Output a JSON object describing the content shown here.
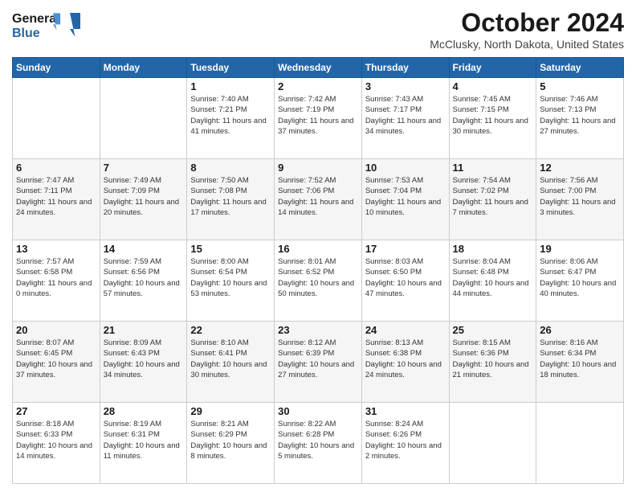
{
  "logo": {
    "line1": "General",
    "line2": "Blue"
  },
  "title": "October 2024",
  "location": "McClusky, North Dakota, United States",
  "days_of_week": [
    "Sunday",
    "Monday",
    "Tuesday",
    "Wednesday",
    "Thursday",
    "Friday",
    "Saturday"
  ],
  "weeks": [
    [
      {
        "day": "",
        "sunrise": "",
        "sunset": "",
        "daylight": ""
      },
      {
        "day": "",
        "sunrise": "",
        "sunset": "",
        "daylight": ""
      },
      {
        "day": "1",
        "sunrise": "Sunrise: 7:40 AM",
        "sunset": "Sunset: 7:21 PM",
        "daylight": "Daylight: 11 hours and 41 minutes."
      },
      {
        "day": "2",
        "sunrise": "Sunrise: 7:42 AM",
        "sunset": "Sunset: 7:19 PM",
        "daylight": "Daylight: 11 hours and 37 minutes."
      },
      {
        "day": "3",
        "sunrise": "Sunrise: 7:43 AM",
        "sunset": "Sunset: 7:17 PM",
        "daylight": "Daylight: 11 hours and 34 minutes."
      },
      {
        "day": "4",
        "sunrise": "Sunrise: 7:45 AM",
        "sunset": "Sunset: 7:15 PM",
        "daylight": "Daylight: 11 hours and 30 minutes."
      },
      {
        "day": "5",
        "sunrise": "Sunrise: 7:46 AM",
        "sunset": "Sunset: 7:13 PM",
        "daylight": "Daylight: 11 hours and 27 minutes."
      }
    ],
    [
      {
        "day": "6",
        "sunrise": "Sunrise: 7:47 AM",
        "sunset": "Sunset: 7:11 PM",
        "daylight": "Daylight: 11 hours and 24 minutes."
      },
      {
        "day": "7",
        "sunrise": "Sunrise: 7:49 AM",
        "sunset": "Sunset: 7:09 PM",
        "daylight": "Daylight: 11 hours and 20 minutes."
      },
      {
        "day": "8",
        "sunrise": "Sunrise: 7:50 AM",
        "sunset": "Sunset: 7:08 PM",
        "daylight": "Daylight: 11 hours and 17 minutes."
      },
      {
        "day": "9",
        "sunrise": "Sunrise: 7:52 AM",
        "sunset": "Sunset: 7:06 PM",
        "daylight": "Daylight: 11 hours and 14 minutes."
      },
      {
        "day": "10",
        "sunrise": "Sunrise: 7:53 AM",
        "sunset": "Sunset: 7:04 PM",
        "daylight": "Daylight: 11 hours and 10 minutes."
      },
      {
        "day": "11",
        "sunrise": "Sunrise: 7:54 AM",
        "sunset": "Sunset: 7:02 PM",
        "daylight": "Daylight: 11 hours and 7 minutes."
      },
      {
        "day": "12",
        "sunrise": "Sunrise: 7:56 AM",
        "sunset": "Sunset: 7:00 PM",
        "daylight": "Daylight: 11 hours and 3 minutes."
      }
    ],
    [
      {
        "day": "13",
        "sunrise": "Sunrise: 7:57 AM",
        "sunset": "Sunset: 6:58 PM",
        "daylight": "Daylight: 11 hours and 0 minutes."
      },
      {
        "day": "14",
        "sunrise": "Sunrise: 7:59 AM",
        "sunset": "Sunset: 6:56 PM",
        "daylight": "Daylight: 10 hours and 57 minutes."
      },
      {
        "day": "15",
        "sunrise": "Sunrise: 8:00 AM",
        "sunset": "Sunset: 6:54 PM",
        "daylight": "Daylight: 10 hours and 53 minutes."
      },
      {
        "day": "16",
        "sunrise": "Sunrise: 8:01 AM",
        "sunset": "Sunset: 6:52 PM",
        "daylight": "Daylight: 10 hours and 50 minutes."
      },
      {
        "day": "17",
        "sunrise": "Sunrise: 8:03 AM",
        "sunset": "Sunset: 6:50 PM",
        "daylight": "Daylight: 10 hours and 47 minutes."
      },
      {
        "day": "18",
        "sunrise": "Sunrise: 8:04 AM",
        "sunset": "Sunset: 6:48 PM",
        "daylight": "Daylight: 10 hours and 44 minutes."
      },
      {
        "day": "19",
        "sunrise": "Sunrise: 8:06 AM",
        "sunset": "Sunset: 6:47 PM",
        "daylight": "Daylight: 10 hours and 40 minutes."
      }
    ],
    [
      {
        "day": "20",
        "sunrise": "Sunrise: 8:07 AM",
        "sunset": "Sunset: 6:45 PM",
        "daylight": "Daylight: 10 hours and 37 minutes."
      },
      {
        "day": "21",
        "sunrise": "Sunrise: 8:09 AM",
        "sunset": "Sunset: 6:43 PM",
        "daylight": "Daylight: 10 hours and 34 minutes."
      },
      {
        "day": "22",
        "sunrise": "Sunrise: 8:10 AM",
        "sunset": "Sunset: 6:41 PM",
        "daylight": "Daylight: 10 hours and 30 minutes."
      },
      {
        "day": "23",
        "sunrise": "Sunrise: 8:12 AM",
        "sunset": "Sunset: 6:39 PM",
        "daylight": "Daylight: 10 hours and 27 minutes."
      },
      {
        "day": "24",
        "sunrise": "Sunrise: 8:13 AM",
        "sunset": "Sunset: 6:38 PM",
        "daylight": "Daylight: 10 hours and 24 minutes."
      },
      {
        "day": "25",
        "sunrise": "Sunrise: 8:15 AM",
        "sunset": "Sunset: 6:36 PM",
        "daylight": "Daylight: 10 hours and 21 minutes."
      },
      {
        "day": "26",
        "sunrise": "Sunrise: 8:16 AM",
        "sunset": "Sunset: 6:34 PM",
        "daylight": "Daylight: 10 hours and 18 minutes."
      }
    ],
    [
      {
        "day": "27",
        "sunrise": "Sunrise: 8:18 AM",
        "sunset": "Sunset: 6:33 PM",
        "daylight": "Daylight: 10 hours and 14 minutes."
      },
      {
        "day": "28",
        "sunrise": "Sunrise: 8:19 AM",
        "sunset": "Sunset: 6:31 PM",
        "daylight": "Daylight: 10 hours and 11 minutes."
      },
      {
        "day": "29",
        "sunrise": "Sunrise: 8:21 AM",
        "sunset": "Sunset: 6:29 PM",
        "daylight": "Daylight: 10 hours and 8 minutes."
      },
      {
        "day": "30",
        "sunrise": "Sunrise: 8:22 AM",
        "sunset": "Sunset: 6:28 PM",
        "daylight": "Daylight: 10 hours and 5 minutes."
      },
      {
        "day": "31",
        "sunrise": "Sunrise: 8:24 AM",
        "sunset": "Sunset: 6:26 PM",
        "daylight": "Daylight: 10 hours and 2 minutes."
      },
      {
        "day": "",
        "sunrise": "",
        "sunset": "",
        "daylight": ""
      },
      {
        "day": "",
        "sunrise": "",
        "sunset": "",
        "daylight": ""
      }
    ]
  ]
}
